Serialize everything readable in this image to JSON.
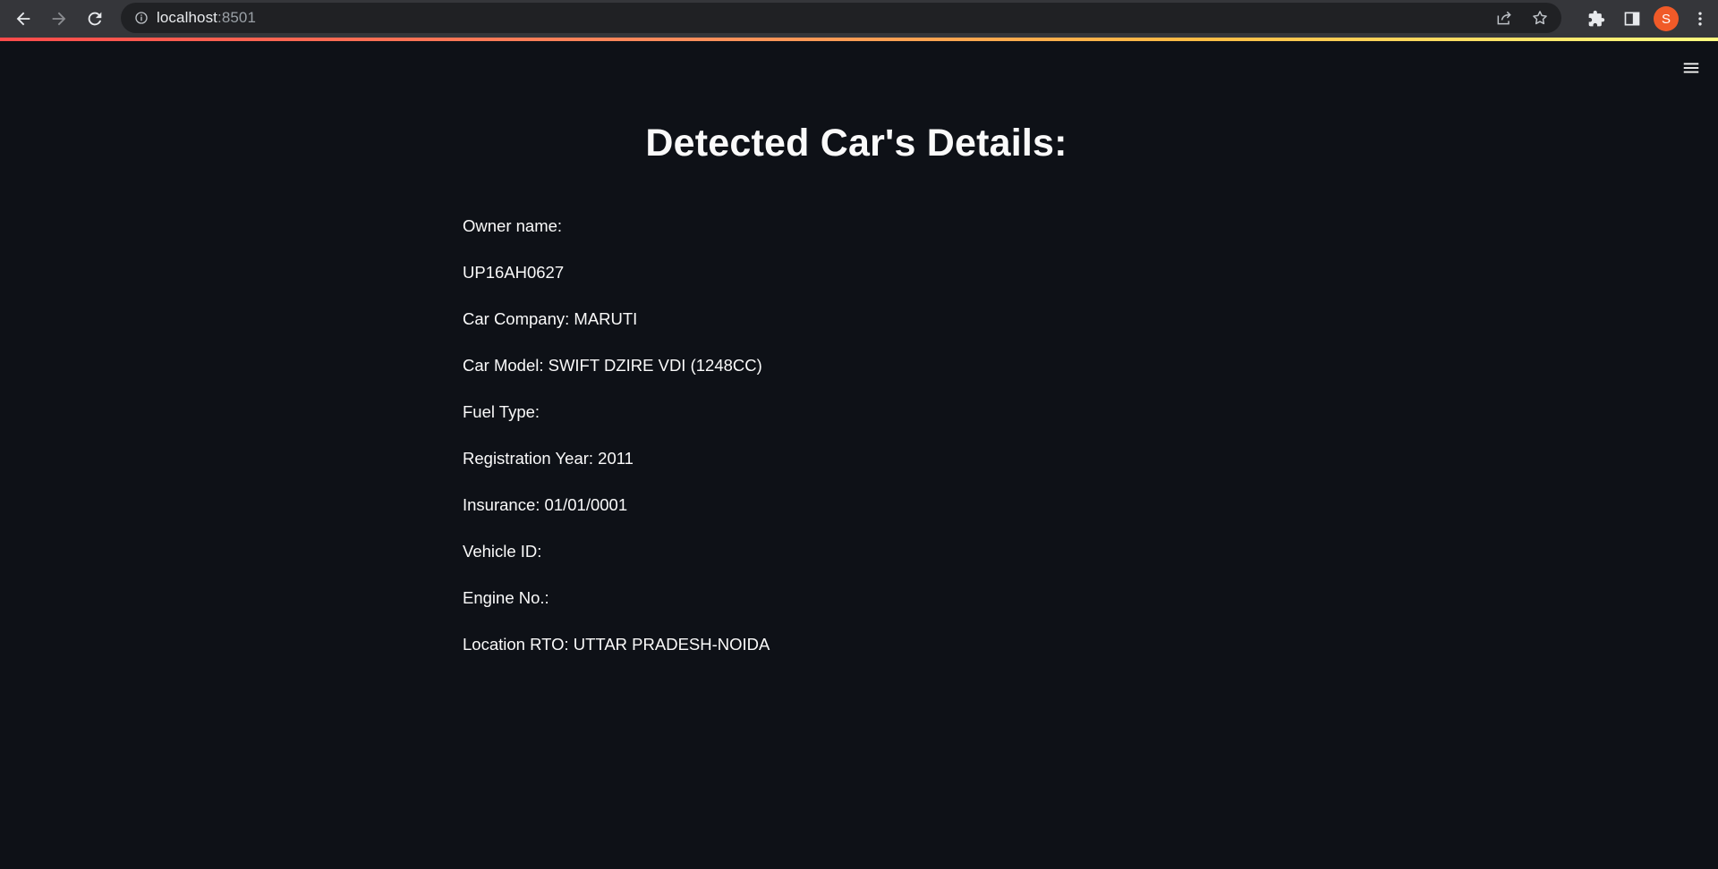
{
  "browser": {
    "url_host": "localhost",
    "url_port": ":8501",
    "avatar_letter": "S",
    "icons": {
      "back": "arrow-left-icon",
      "forward": "arrow-right-icon",
      "reload": "reload-icon",
      "site_info": "info-icon",
      "share": "share-icon",
      "bookmark": "star-icon",
      "extensions": "puzzle-icon",
      "side_panel": "side-panel-icon",
      "menu": "kebab-menu-icon"
    }
  },
  "app": {
    "menu_icon": "hamburger-icon",
    "title": "Detected Car's Details:",
    "details": [
      "Owner name:",
      "UP16AH0627",
      "Car Company: MARUTI",
      "Car Model: SWIFT DZIRE VDI (1248CC)",
      "Fuel Type:",
      "Registration Year: 2011",
      "Insurance: 01/01/0001",
      "Vehicle ID:",
      "Engine No.:",
      "Location RTO: UTTAR PRADESH-NOIDA"
    ]
  },
  "colors": {
    "background": "#0e1117",
    "text": "#fafafa",
    "avatar": "#f05a28"
  }
}
